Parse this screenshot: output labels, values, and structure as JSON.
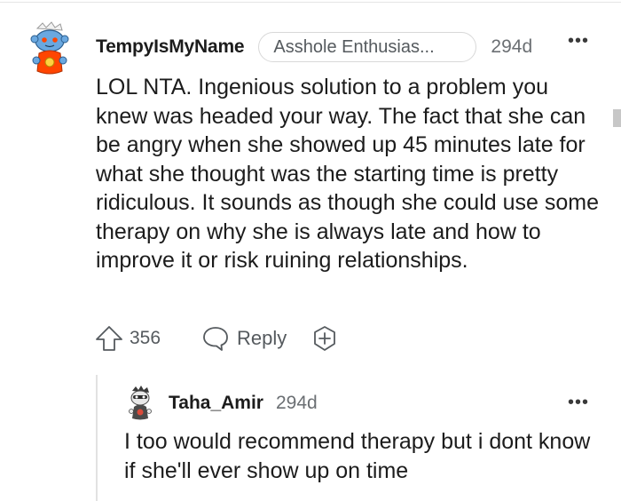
{
  "comment": {
    "username": "TempyIsMyName",
    "flair": "Asshole Enthusias...",
    "timestamp": "294d",
    "more_label": "•••",
    "body": "LOL NTA. Ingenious solution to a problem you knew was headed your way. The fact that she can be angry when she showed up 45 minutes late for what she thought was the starting time is pretty ridiculous. It sounds as though she could use some therapy on why she is always late and how to improve it or risk ruining relationships.",
    "actions": {
      "upvote_icon": "arrow-up-icon",
      "vote_count": "356",
      "reply_icon": "speech-bubble-icon",
      "reply_label": "Reply",
      "award_icon": "plus-award-icon"
    }
  },
  "reply": {
    "username": "Taha_Amir",
    "timestamp": "294d",
    "more_label": "•••",
    "body": "I too would recommend therapy but i dont know if she'll ever show up on time"
  },
  "colors": {
    "text": "#1c1c1c",
    "muted": "#6b6f73",
    "flair_border": "#d8d8d8",
    "thread_line": "#e2e2e2",
    "avatar_orange": "#ff4500"
  }
}
